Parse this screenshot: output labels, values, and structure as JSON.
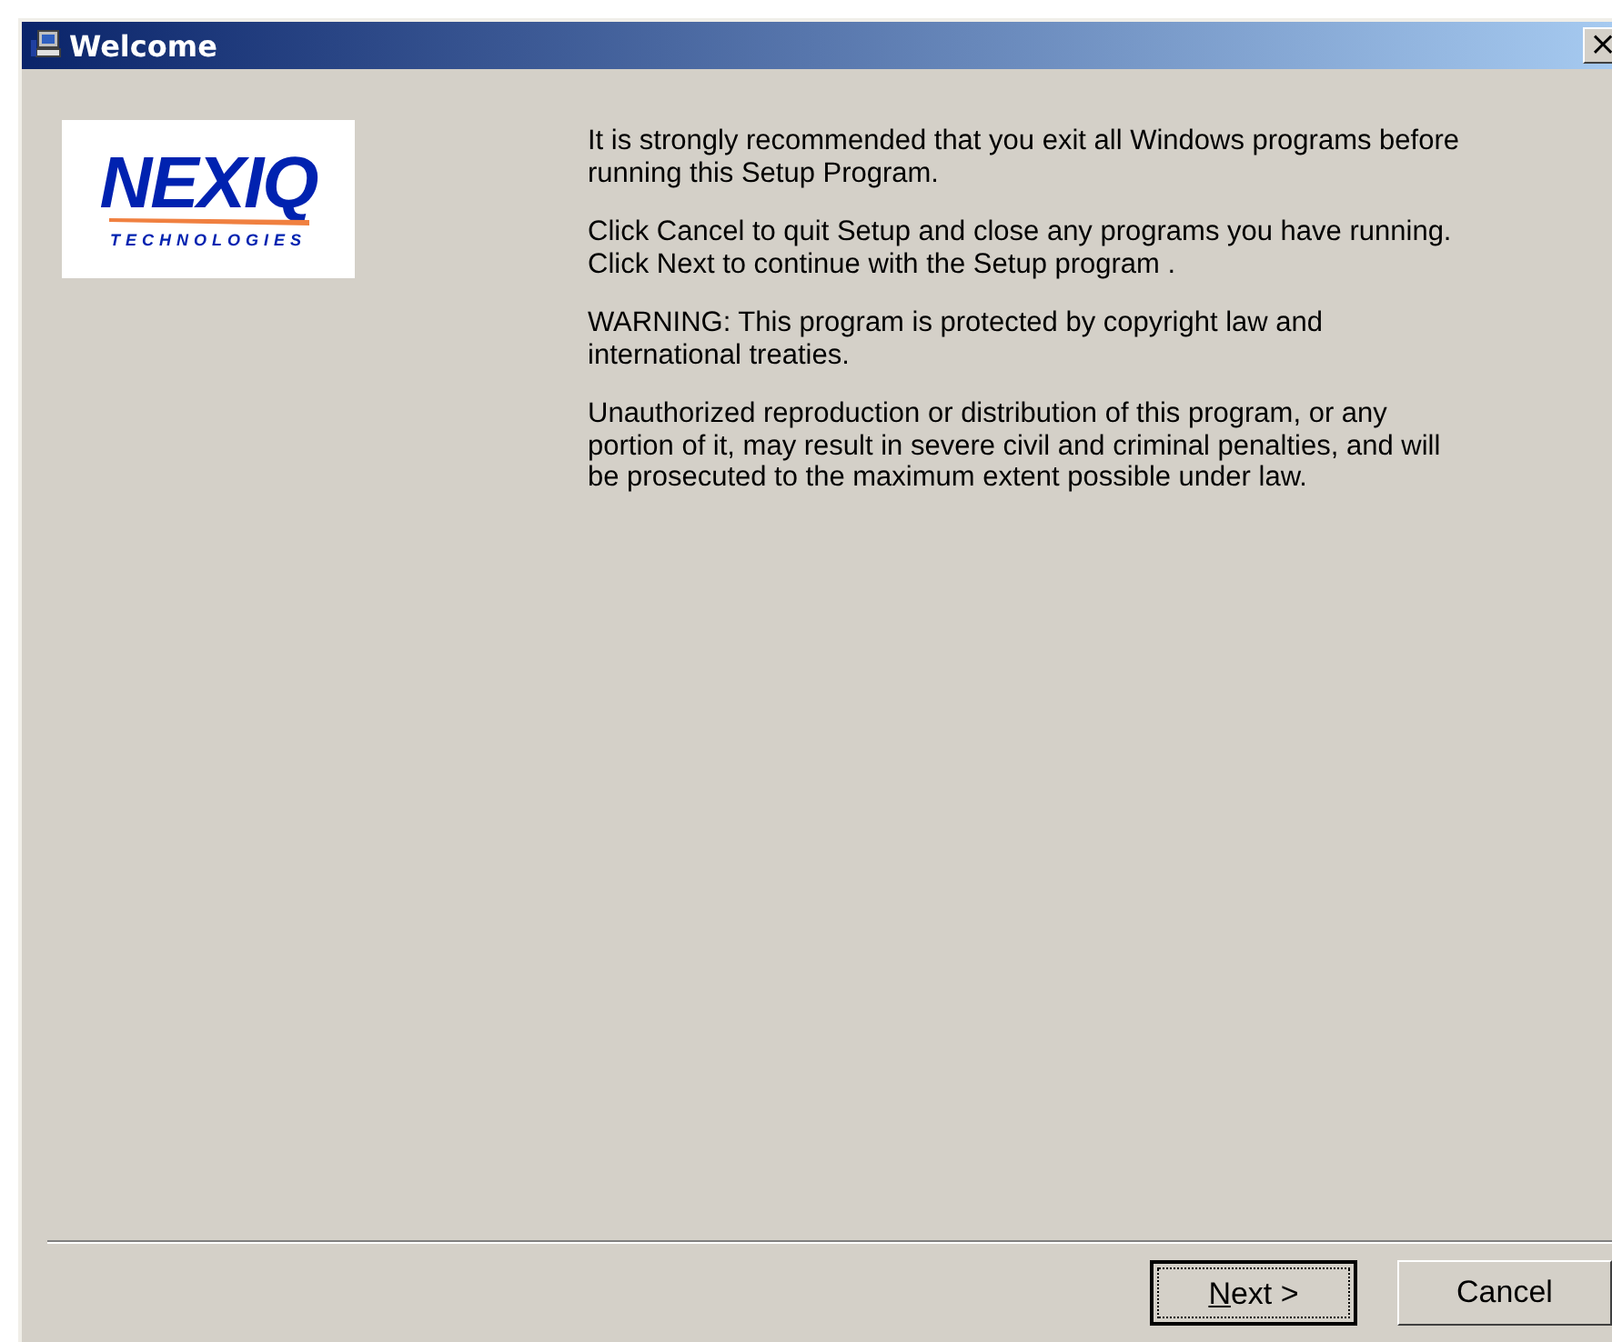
{
  "window": {
    "title": "Welcome",
    "close": "×"
  },
  "logo": {
    "name": "NEXIQ",
    "tagline": "TECHNOLOGIES"
  },
  "paragraphs": [
    "It is strongly recommended that you exit all Windows programs before running this Setup Program.",
    "Click Cancel to quit Setup and close any programs you have running.  Click Next to continue with the Setup program .",
    "WARNING: This program is protected by copyright law and international treaties.",
    "Unauthorized reproduction or distribution of this program, or any portion of it, may result in severe civil and criminal penalties, and will be prosecuted to the maximum extent possible under law."
  ],
  "buttons": [
    {
      "label": "Next >",
      "default": true
    },
    {
      "label": "Cancel",
      "default": false
    }
  ]
}
